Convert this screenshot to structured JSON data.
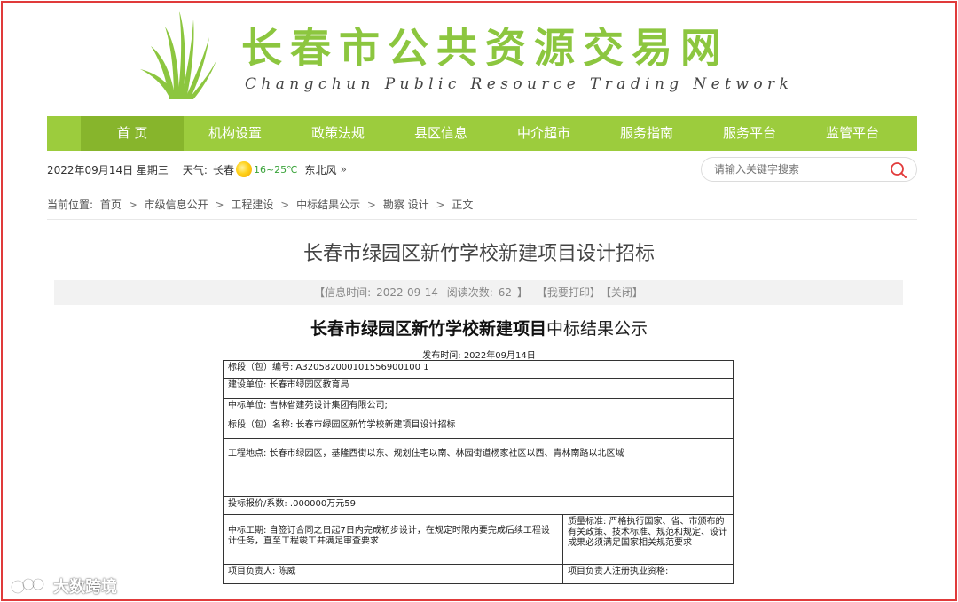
{
  "site": {
    "name_cn": "长春市公共资源交易网",
    "name_en": "Changchun Public Resource Trading Network",
    "brand_green": "#9ccc3d"
  },
  "nav": {
    "items": [
      {
        "label": "首 页",
        "active": true
      },
      {
        "label": "机构设置"
      },
      {
        "label": "政策法规"
      },
      {
        "label": "县区信息"
      },
      {
        "label": "中介超市"
      },
      {
        "label": "服务指南"
      },
      {
        "label": "服务平台"
      },
      {
        "label": "监管平台"
      }
    ]
  },
  "infobar": {
    "date": "2022年09月14日 星期三",
    "weather_label": "天气:",
    "city": "长春",
    "weather_icon": "sun-icon",
    "temperature": "16~25℃",
    "wind": "东北风",
    "more": "»"
  },
  "search": {
    "placeholder": "请输入关键字搜索",
    "icon": "search-icon"
  },
  "breadcrumb": {
    "prefix": "当前位置:",
    "items": [
      "首页",
      "市级信息公开",
      "工程建设",
      "中标结果公示",
      "勘察 设计",
      "正文"
    ],
    "separator": ">"
  },
  "article": {
    "title": "长春市绿园区新竹学校新建项目设计招标",
    "meta": {
      "time_label": "【信息时间:",
      "time": "2022-09-14",
      "reads_label": "阅读次数:",
      "reads": "62",
      "close_bracket": "】",
      "print": "【我要打印】",
      "close": "【关闭】"
    }
  },
  "document": {
    "title_bold": "长春市绿园区新竹学校新建项目",
    "title_rest": "中标结果公示",
    "publish_time": "发布时间: 2022年09月14日",
    "rows": {
      "section_no": "标段（包）编号: A320582000101556900100 1",
      "builder": "建设单位: 长春市绿园区教育局",
      "winner": "中标单位: 吉林省建苑设计集团有限公司;",
      "section_name": "标段（包）名称: 长春市绿园区新竹学校新建项目设计招标",
      "location": "工程地点: 长春市绿园区，基隆西街以东、规划住宅以南、林园街道杨家社区以西、青林南路以北区域",
      "bid_price": "投标报价/系数: .000000万元59",
      "duration": "中标工期: 自签订合同之日起7日内完成初步设计，在规定时限内要完成后续工程设计任务，直至工程竣工并满足审查要求",
      "quality": "质量标准: 严格执行国家、省、市颁布的有关政策、技术标准、规范和规定、设计成果必须满足国家相关规范要求",
      "manager": "项目负责人: 陈威",
      "manager_cert": "项目负责人注册执业资格:"
    }
  },
  "watermark": {
    "text": "大数跨境",
    "icon": "watermark-logo-icon"
  }
}
